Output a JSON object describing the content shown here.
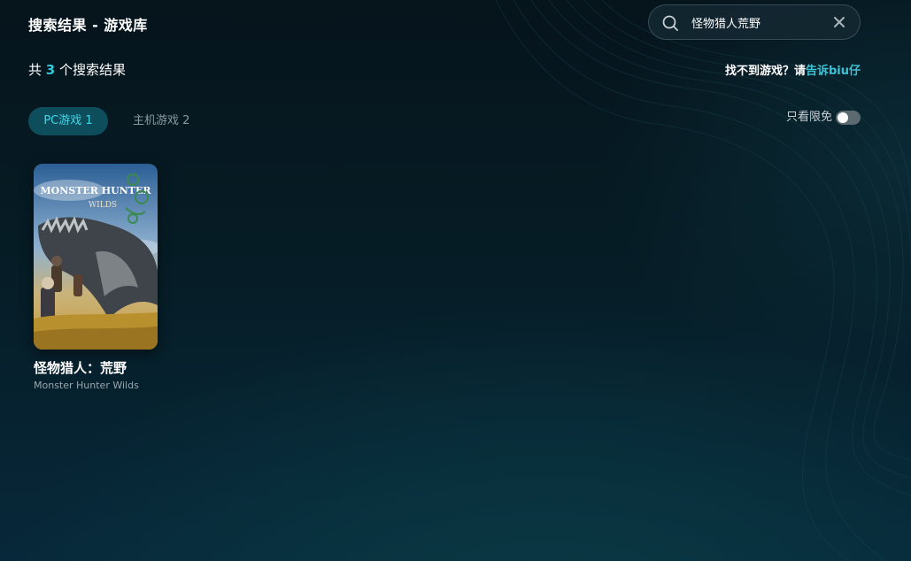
{
  "header": {
    "title": "搜索结果 - 游戏库"
  },
  "search": {
    "value": "怪物猎人荒野",
    "placeholder": ""
  },
  "results": {
    "prefix": "共",
    "count": "3",
    "suffix": "个搜索结果"
  },
  "feedback": {
    "text": "找不到游戏？请",
    "link": "告诉biu仔"
  },
  "tabs": [
    {
      "label": "PC游戏 1",
      "active": true
    },
    {
      "label": "主机游戏 2",
      "active": false
    }
  ],
  "filter": {
    "free_only_label": "只看限免",
    "free_only_on": false
  },
  "games": [
    {
      "title": "怪物猎人：荒野",
      "subtitle": "Monster Hunter Wilds",
      "cover_logo_line1": "MONSTER HUNTER",
      "cover_logo_line2": "WILDS"
    }
  ],
  "colors": {
    "accent": "#33c8d8",
    "tab_active_bg": "#0e4e5c",
    "background": "#06141c"
  },
  "icons": {
    "search": "search-icon",
    "clear": "close-icon"
  }
}
